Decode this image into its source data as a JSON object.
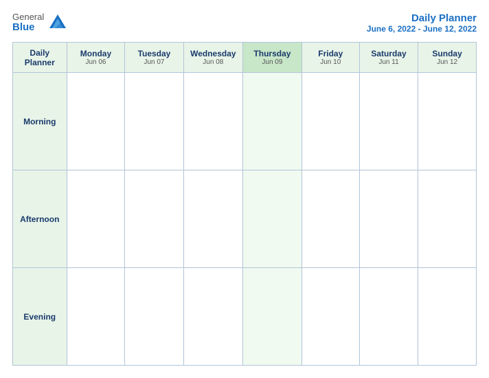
{
  "logo": {
    "general": "General",
    "blue": "Blue"
  },
  "header": {
    "title": "Daily Planner",
    "date_range": "June 6, 2022 - June 12, 2022"
  },
  "table": {
    "label_header": "Daily\nPlanner",
    "columns": [
      {
        "day": "Monday",
        "date": "Jun 06",
        "highlighted": false
      },
      {
        "day": "Tuesday",
        "date": "Jun 07",
        "highlighted": false
      },
      {
        "day": "Wednesday",
        "date": "Jun 08",
        "highlighted": false
      },
      {
        "day": "Thursday",
        "date": "Jun 09",
        "highlighted": true
      },
      {
        "day": "Friday",
        "date": "Jun 10",
        "highlighted": false
      },
      {
        "day": "Saturday",
        "date": "Jun 11",
        "highlighted": false
      },
      {
        "day": "Sunday",
        "date": "Jun 12",
        "highlighted": false
      }
    ],
    "rows": [
      {
        "label": "Morning"
      },
      {
        "label": "Afternoon"
      },
      {
        "label": "Evening"
      }
    ]
  }
}
